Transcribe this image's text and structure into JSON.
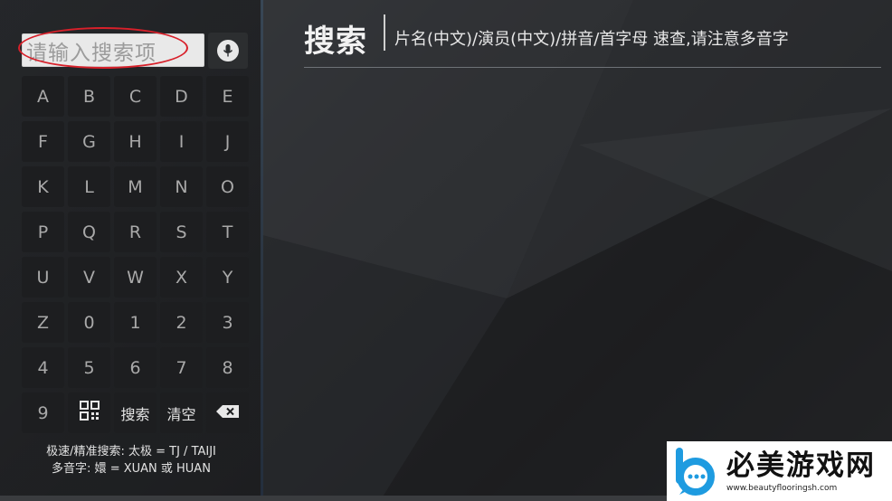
{
  "search": {
    "placeholder": "请输入搜索项"
  },
  "header": {
    "title": "搜索",
    "subtitle": "片名(中文)/演员(中文)/拼音/首字母 速查,请注意多音字"
  },
  "keyboard": {
    "keys": [
      "A",
      "B",
      "C",
      "D",
      "E",
      "F",
      "G",
      "H",
      "I",
      "J",
      "K",
      "L",
      "M",
      "N",
      "O",
      "P",
      "Q",
      "R",
      "S",
      "T",
      "U",
      "V",
      "W",
      "X",
      "Y",
      "Z",
      "0",
      "1",
      "2",
      "3",
      "4",
      "5",
      "6",
      "7",
      "8"
    ],
    "last_row": {
      "nine": "9",
      "qr_icon": "qr-code-icon",
      "search_label": "搜索",
      "clear_label": "清空",
      "backspace_icon": "backspace-icon"
    }
  },
  "hints": {
    "line1": "极速/精准搜索: 太极 = TJ / TAIJI",
    "line2": "多音字: 嬛 = XUAN 或 HUAN"
  },
  "watermark": {
    "title": "必美游戏网",
    "url": "www.beautyflooringsh.com"
  },
  "colors": {
    "highlight_ring": "#d8202a",
    "key_bg": "#1d1e20",
    "key_text": "#a9a9a9"
  }
}
